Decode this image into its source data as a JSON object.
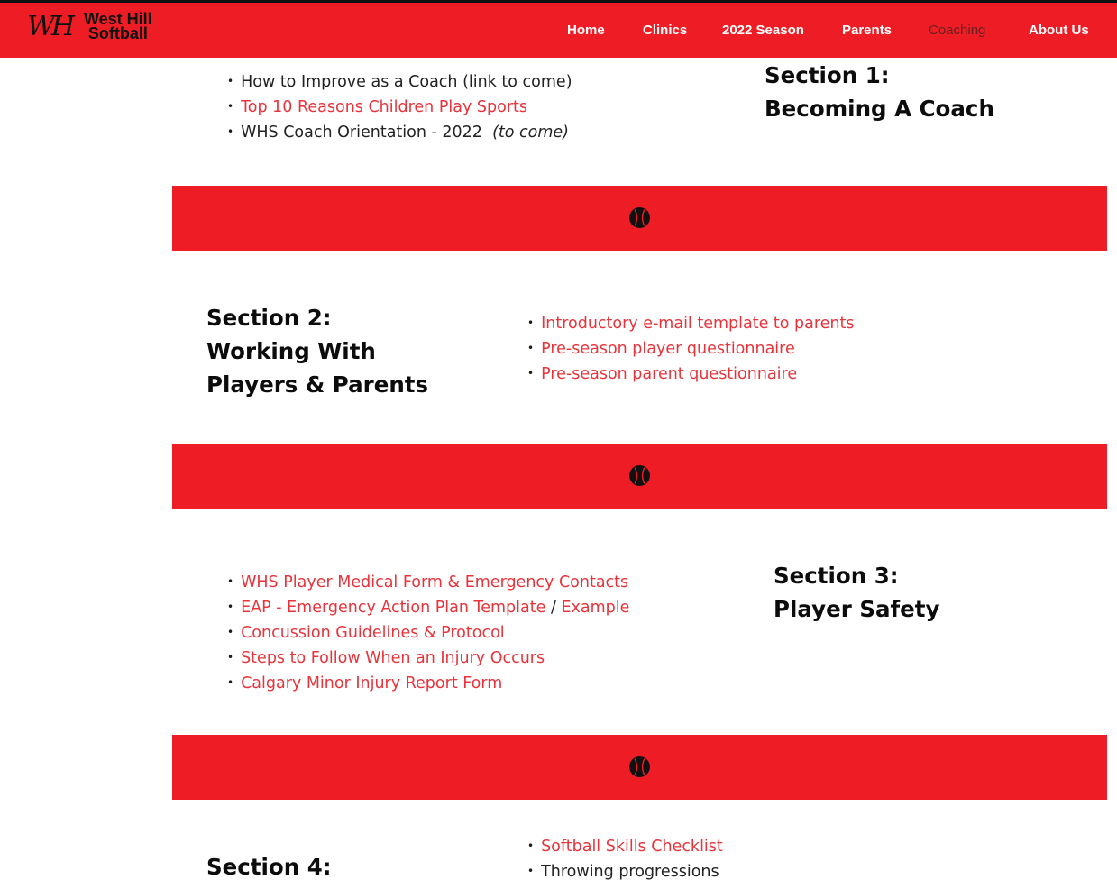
{
  "header": {
    "logo_mark": "WH",
    "logo_line1": "West Hill",
    "logo_line2": "Softball",
    "nav": [
      "Home",
      "Clinics",
      "2022 Season",
      "Parents",
      "Coaching",
      "About Us"
    ],
    "active_nav": "Coaching"
  },
  "section1": {
    "title_line1": "Section 1:",
    "title_line2": "Becoming A Coach",
    "items": [
      {
        "text": "How to Improve as a Coach (link to come)"
      },
      {
        "text": "Top 10 Reasons Children Play Sports"
      },
      {
        "text": "WHS Coach Orientation - 2022",
        "note": "(to come)"
      }
    ]
  },
  "section2": {
    "title_line1": "Section 2:",
    "title_line2": "Working With",
    "title_line3": "Players & Parents",
    "items": [
      "Introductory e-mail template to parents",
      "Pre-season player questionnaire",
      "Pre-season parent questionnaire"
    ]
  },
  "section3": {
    "title_line1": "Section 3:",
    "title_line2": "Player Safety",
    "items": [
      "WHS Player Medical Form & Emergency Contacts",
      "EAP - Emergency Action Plan Template",
      "Example",
      "Concussion Guidelines & Protocol",
      "Steps to Follow When an Injury Occurs",
      "Calgary Minor Injury Report Form"
    ],
    "separator": "/"
  },
  "section4": {
    "title_line1": "Section 4:",
    "items": [
      "Softball Skills Checklist",
      "Throwing progressions"
    ]
  },
  "divider_icon": "softball-icon",
  "colors": {
    "brand_red": "#ee1c25",
    "link_red": "#e8333b",
    "text": "#1a1a1a"
  }
}
